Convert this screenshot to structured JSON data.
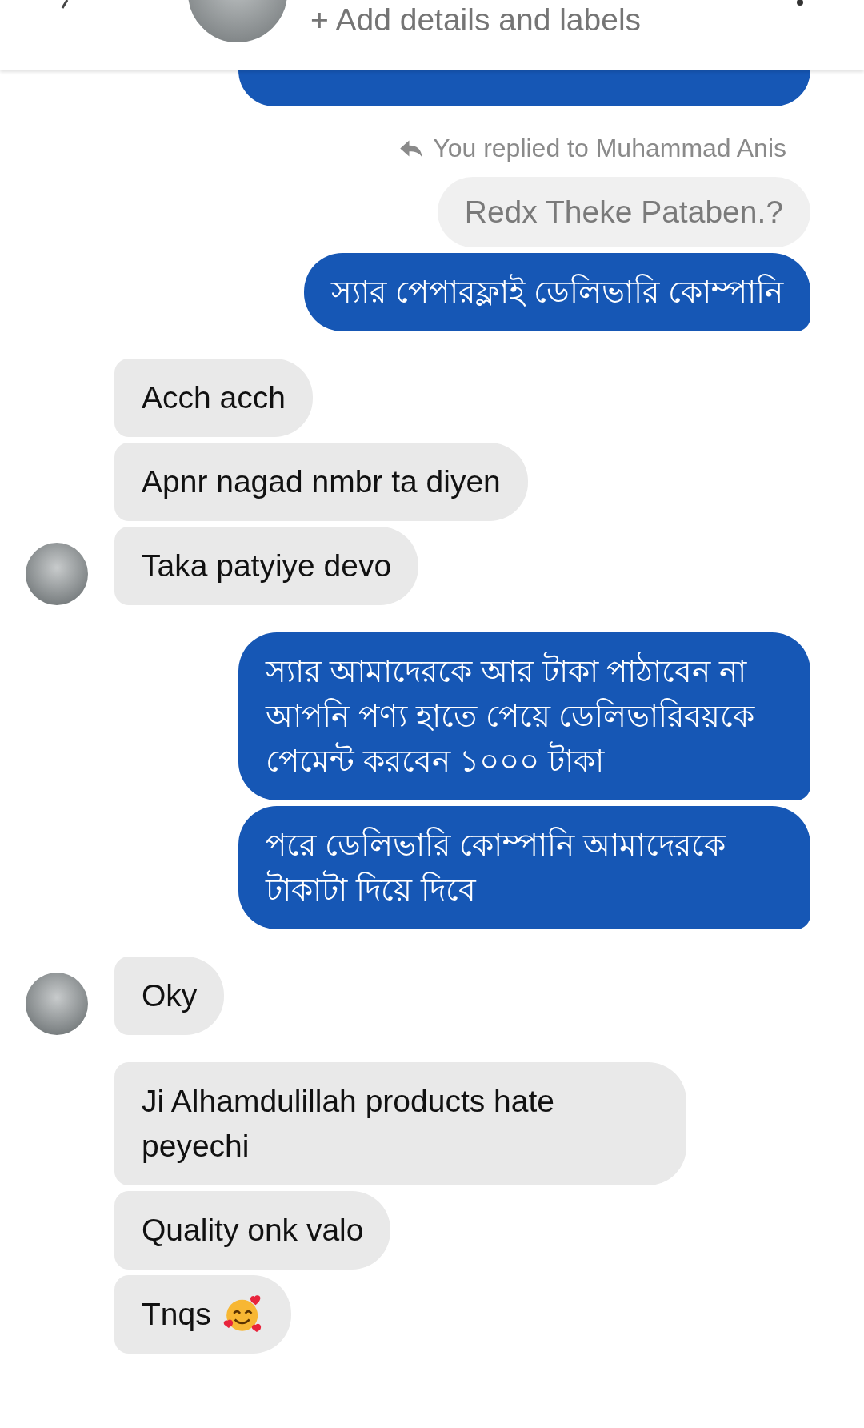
{
  "header": {
    "subtitle": "+ Add details and labels"
  },
  "groups": [
    {
      "kind": "sent",
      "messages": [
        {
          "kind": "clipped"
        }
      ]
    },
    {
      "kind": "sent",
      "messages": [
        {
          "kind": "reply_note",
          "text": "You replied to Muhammad Anis"
        },
        {
          "kind": "quoted",
          "text": "Redx Theke Pataben.?"
        },
        {
          "kind": "text",
          "text": "স্যার পেপারফ্লাই ডেলিভারি কোম্পানি"
        }
      ]
    },
    {
      "kind": "received",
      "messages": [
        {
          "kind": "text",
          "text": "Acch acch",
          "avatar": false
        },
        {
          "kind": "text",
          "text": "Apnr nagad nmbr ta diyen",
          "avatar": false
        },
        {
          "kind": "text",
          "text": "Taka patyiye devo",
          "avatar": true
        }
      ]
    },
    {
      "kind": "sent",
      "messages": [
        {
          "kind": "text",
          "text": "স্যার আমাদেরকে আর টাকা পাঠাবেন না আপনি পণ্য হাতে পেয়ে ডেলিভারিবয়কে পেমেন্ট করবেন ১০০০ টাকা"
        },
        {
          "kind": "text",
          "text": "পরে ডেলিভারি কোম্পানি আমাদেরকে টাকাটা দিয়ে দিবে"
        }
      ]
    },
    {
      "kind": "received",
      "messages": [
        {
          "kind": "text",
          "text": "Oky",
          "avatar": true
        }
      ]
    },
    {
      "kind": "received",
      "messages": [
        {
          "kind": "text",
          "text": "Ji Alhamdulillah products hate peyechi",
          "avatar": false
        },
        {
          "kind": "text",
          "text": "Quality onk valo",
          "avatar": false
        },
        {
          "kind": "emoji_text",
          "text": "Tnqs",
          "avatar": false
        }
      ]
    }
  ]
}
